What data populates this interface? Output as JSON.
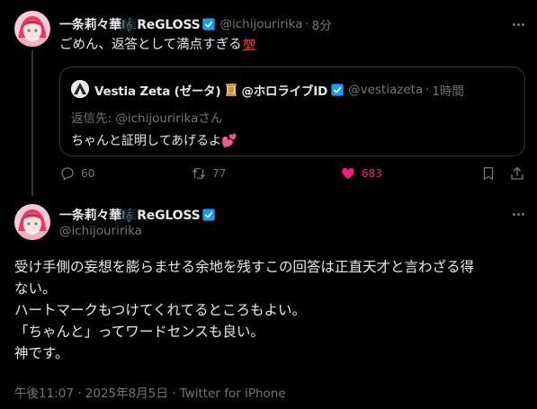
{
  "colors": {
    "background": "#000000",
    "text": "#e7e9ea",
    "muted": "#71767b",
    "verified": "#1d9bf0",
    "like": "#f91880",
    "border": "#2f3336"
  },
  "tweet1": {
    "display_name": "一条莉々華🎼ReGLOSS",
    "handle": "@ichijouririka",
    "separator": "·",
    "time": "8分",
    "text": "ごめん、返答として満点すぎる",
    "emoji": "💯",
    "quoted": {
      "display_name": "Vestia Zeta (ゼータ)",
      "affiliation": "@ホロライブID",
      "handle": "@vestiazeta",
      "separator": "·",
      "time": "1時間",
      "reply_to": "返信先: @ichijouririkaさん",
      "text": "ちゃんと証明してあげるよ",
      "text_emoji": "💕"
    },
    "actions": {
      "reply_count": "60",
      "retweet_count": "77",
      "like_count": "683"
    }
  },
  "tweet2": {
    "display_name": "一条莉々華🎼ReGLOSS",
    "handle": "@ichijouririka",
    "body_lines": [
      "受け手側の妄想を膨らませる余地を残すこの回答は正直天才と言わざる得",
      "ない。",
      "ハートマークもつけてくれてるところもよい。",
      "「ちゃんと」ってワードセンスも良い。",
      "神です。"
    ],
    "timestamp": "午後11:07 · 2025年8月5日 · ",
    "source": "Twitter for iPhone"
  }
}
